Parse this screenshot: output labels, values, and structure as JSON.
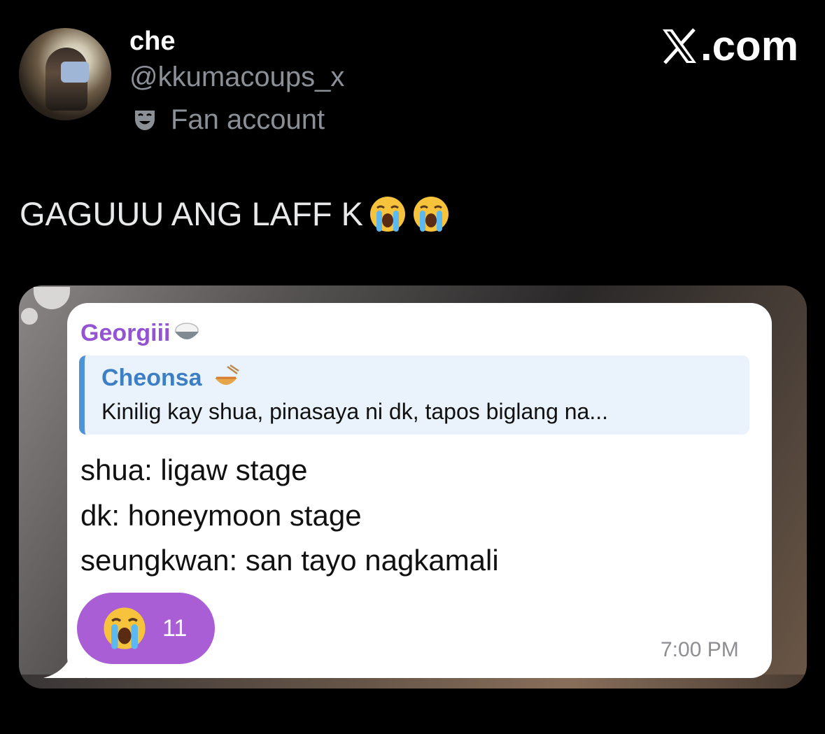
{
  "profile": {
    "display_name": "che",
    "handle": "@kkumacoups_x",
    "label_icon": "theater-mask-icon",
    "label": "Fan account"
  },
  "brand": {
    "text": ".com",
    "icon": "x-logo-icon"
  },
  "tweet": {
    "text": "GAGUUU ANG LAFF K",
    "emojis": [
      "loudly-crying-face-icon",
      "loudly-crying-face-icon"
    ]
  },
  "message": {
    "sender": "Georgiii",
    "sender_emoji": "rice-bowl-icon",
    "reply": {
      "name": "Cheonsa",
      "name_emoji": "noodle-bowl-icon",
      "text": "Kinilig kay shua, pinasaya ni dk, tapos biglang na..."
    },
    "lines": [
      "shua: ligaw stage",
      "dk: honeymoon stage",
      "seungkwan: san tayo nagkamali"
    ],
    "reaction": {
      "emoji": "loudly-crying-face-icon",
      "count": "11"
    },
    "time": "7:00 PM"
  },
  "colors": {
    "background": "#000000",
    "sender": "#9353d3",
    "reply_name": "#3d7fc5",
    "reply_bar": "#4f93d6",
    "reaction": "#a95ed6"
  }
}
